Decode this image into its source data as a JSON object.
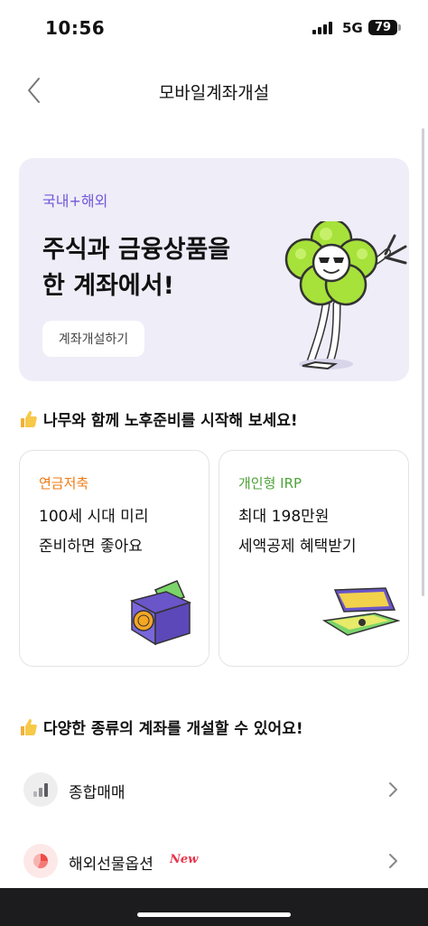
{
  "status_bar": {
    "time": "10:56",
    "network": "5G",
    "battery": "79"
  },
  "header": {
    "title": "모바일계좌개설"
  },
  "hero": {
    "tag": "국내+해외",
    "title_line1": "주식과 금융상품을",
    "title_line2": "한 계좌에서!",
    "button_label": "계좌개설하기"
  },
  "retirement_section": {
    "title": "나무와 함께 노후준비를 시작해 보세요!",
    "cards": [
      {
        "tag": "연금저축",
        "line1": "100세 시대 미리",
        "line2": "준비하면 좋아요",
        "tag_color": "#f07a12"
      },
      {
        "tag": "개인형 IRP",
        "line1": "최대 198만원",
        "line2": "세액공제 혜택받기",
        "tag_color": "#4fa33a"
      }
    ]
  },
  "accounts_section": {
    "title": "다양한 종류의 계좌를 개설할 수 있어요!",
    "items": [
      {
        "label": "종합매매",
        "icon": "bar-chart-icon"
      },
      {
        "label": "해외선물옵션",
        "badge": "New",
        "icon": "pie-chart-icon"
      }
    ]
  },
  "colors": {
    "accent_purple": "#7157d9",
    "hero_bg": "#efedf8",
    "badge_red": "#e8344a"
  }
}
